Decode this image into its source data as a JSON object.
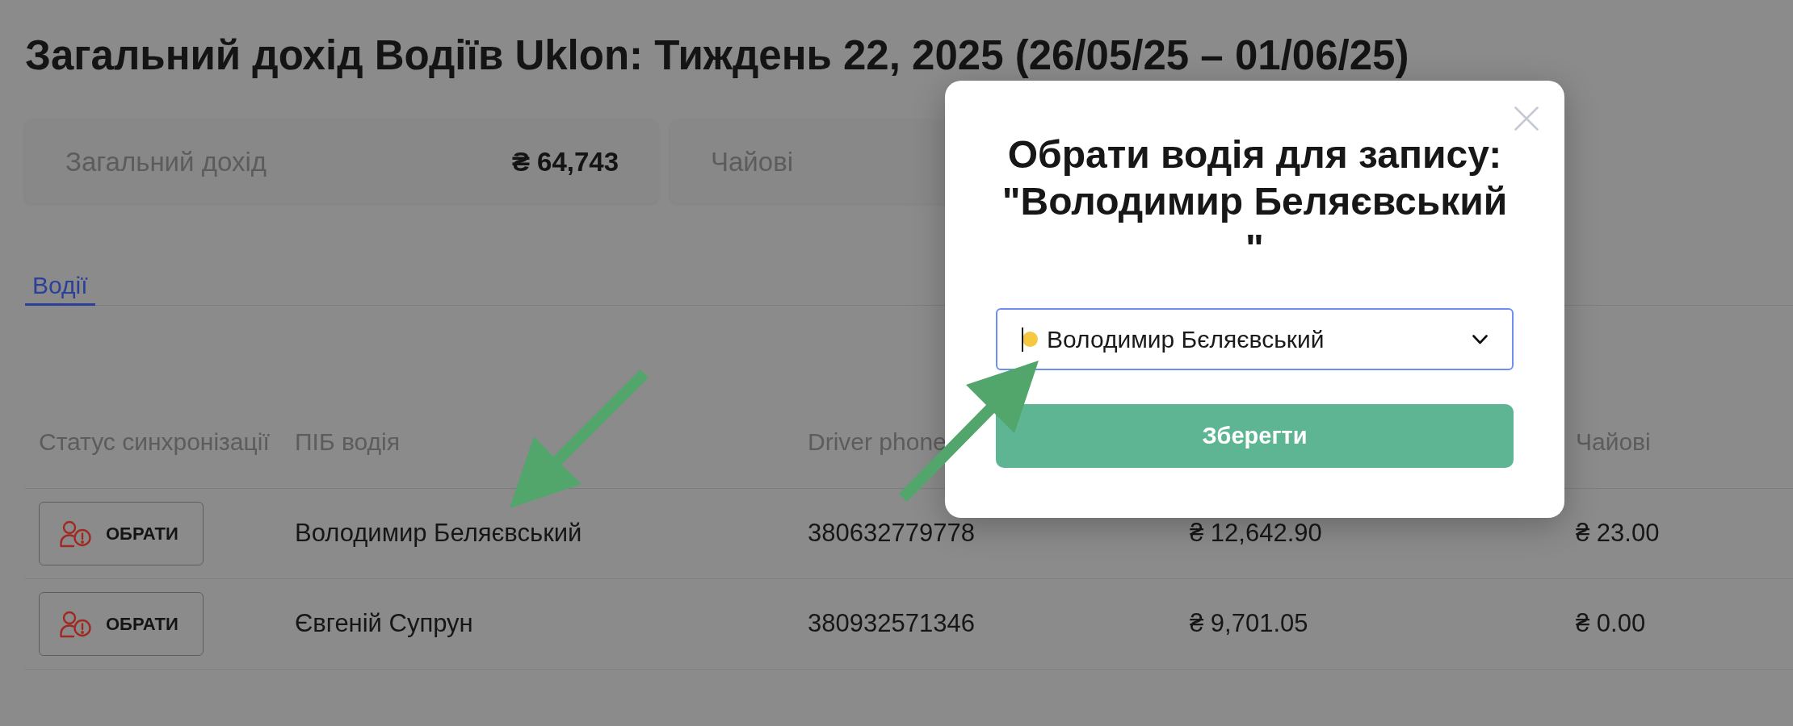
{
  "page": {
    "title": "Загальний дохід Водіїв Uklon: Тиждень 22, 2025 (26/05/25 – 01/06/25)"
  },
  "summary_cards": [
    {
      "label": "Загальний дохід",
      "value": "₴ 64,743"
    },
    {
      "label": "Чайові"
    }
  ],
  "tabs": [
    {
      "label": "Водії",
      "selected": true
    }
  ],
  "table": {
    "columns": {
      "sync_status": "Статус синхронізації",
      "name": "ПІБ водія",
      "phone": "Driver phone",
      "tips": "Чайові"
    },
    "rows": [
      {
        "sync_status": "ОБРАТИ",
        "name": "Володимир Беляєвський",
        "phone": "380632779778",
        "column_4": "₴ 12,642.90",
        "tips": "₴ 23.00"
      },
      {
        "sync_status": "ОБРАТИ",
        "name": "Євгеній Супрун",
        "phone": "380932571346",
        "column_4": "₴ 9,701.05",
        "tips": "₴ 0.00"
      }
    ]
  },
  "modal": {
    "title": "Обрати водія для запису: \"Володимир Беляєвський \"",
    "select": {
      "value": "Володимир Бєляєвський",
      "color": "#f5c842",
      "focused": true
    },
    "save_button": "Зберегти"
  }
}
